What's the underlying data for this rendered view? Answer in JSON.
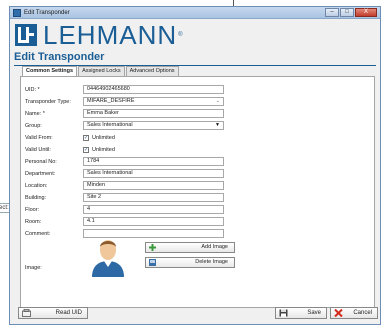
{
  "window": {
    "title": "Edit Transponder",
    "controls": {
      "minimize": "–",
      "maximize": "□",
      "close": "X"
    }
  },
  "left_fragment": {
    "text": "ect:"
  },
  "logo": {
    "text": "LEHMANN",
    "reg": "®"
  },
  "page_title": "Edit Transponder",
  "tabs": [
    {
      "label": "Common Settings",
      "active": true
    },
    {
      "label": "Assigned Locks",
      "active": false
    },
    {
      "label": "Advanced Options",
      "active": false
    }
  ],
  "form": {
    "uid": {
      "label": "UID: *",
      "value": "04464902465680"
    },
    "type": {
      "label": "Transponder Type:",
      "value": "MIFARE_DESFIRE"
    },
    "name": {
      "label": "Name: *",
      "value": "Emma Baker"
    },
    "group": {
      "label": "Group:",
      "value": "Sales International"
    },
    "valid_from": {
      "label": "Valid From:",
      "value": "Unlimited",
      "checked": true
    },
    "valid_until": {
      "label": "Valid Until:",
      "value": "Unlimited",
      "checked": true
    },
    "personal_no": {
      "label": "Personal No:",
      "value": "1784"
    },
    "department": {
      "label": "Department:",
      "value": "Sales International"
    },
    "location": {
      "label": "Location:",
      "value": "Minden"
    },
    "building": {
      "label": "Building:",
      "value": "Site 2"
    },
    "floor": {
      "label": "Floor:",
      "value": "4"
    },
    "room": {
      "label": "Room:",
      "value": "4.1"
    },
    "comment": {
      "label": "Comment:",
      "value": ""
    },
    "image": {
      "label": "Image:"
    }
  },
  "image_buttons": {
    "add": "Add Image",
    "delete": "Delete Image"
  },
  "footer": {
    "read_uid": "Read UID",
    "save": "Save",
    "cancel": "Cancel"
  },
  "colors": {
    "brand": "#1b5e96",
    "add_green": "#3a9a3a",
    "cancel_red": "#d42a1a"
  }
}
